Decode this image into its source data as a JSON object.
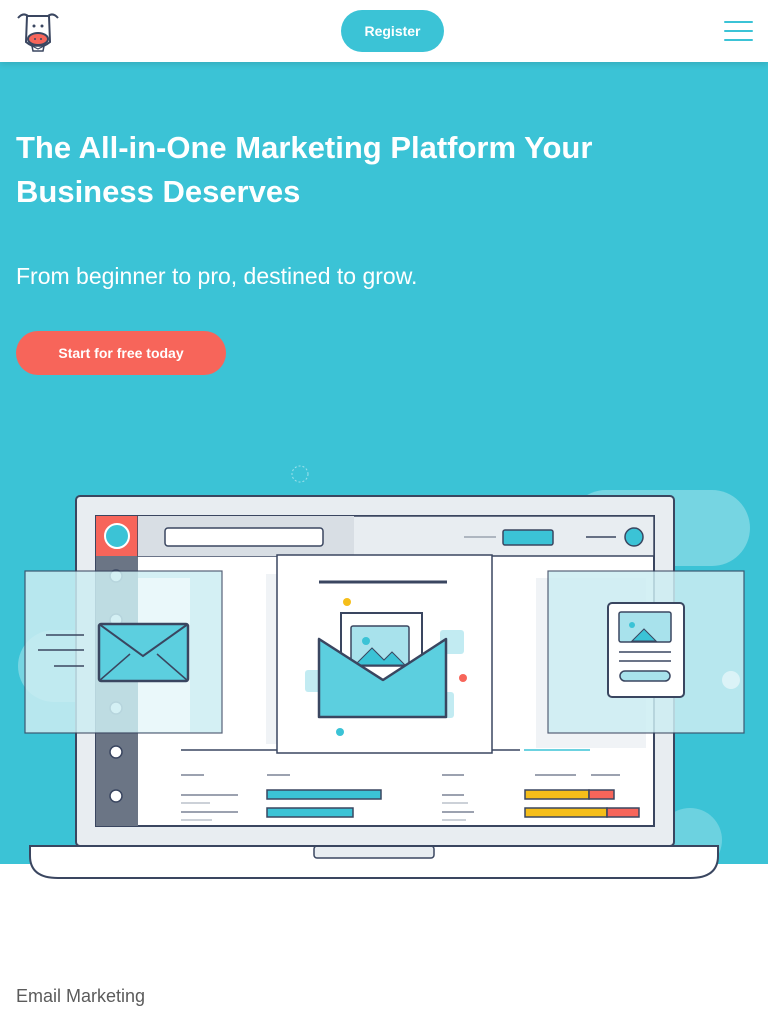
{
  "header": {
    "logo_icon": "cow-mascot-logo-icon",
    "register_label": "Register",
    "menu_icon": "hamburger-menu-icon"
  },
  "hero": {
    "title": "The All-in-One Marketing Platform Your Business Deserves",
    "subtitle": "From beginner to pro, destined to grow.",
    "cta_label": "Start for free today",
    "illustration_icon": "laptop-email-builder-illustration"
  },
  "features": {
    "section_label": "Email Marketing"
  },
  "colors": {
    "brand_teal": "#3bc3d6",
    "cta_coral": "#f7655a",
    "dark_outline": "#3a4660",
    "bar_yellow": "#f5be1a"
  }
}
